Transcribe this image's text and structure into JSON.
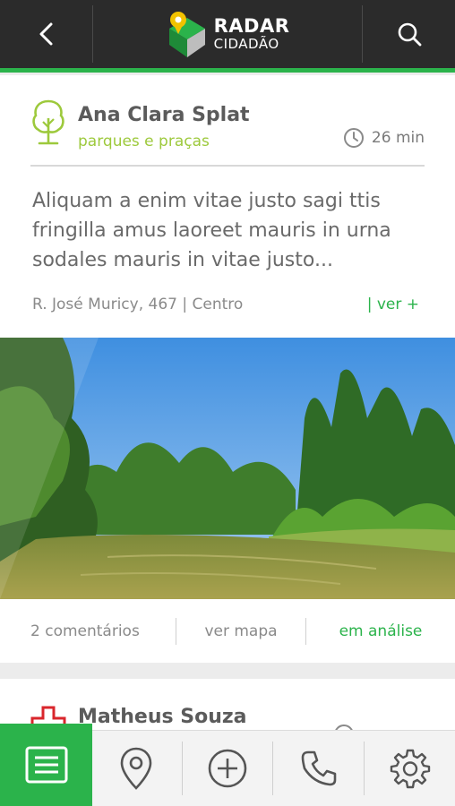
{
  "header": {
    "logo_line1": "RADAR",
    "logo_line2": "CIDADÃO",
    "back_icon": "chevron-left-icon",
    "search_icon": "search-icon",
    "accent": "#2bb34b"
  },
  "post": {
    "author": "Ana Clara Splat",
    "category": "parques e praças",
    "category_icon": "tree-icon",
    "category_color": "#9dc93c",
    "time": "26 min",
    "description": "Aliquam a enim vitae justo sagi ttis fringilla amus laoreet mauris in urna sodales mauris in vitae justo...",
    "address": "R. José Muricy, 467 | Centro",
    "more_link": "| ver +",
    "comments": "2 comentários",
    "map_link": "ver mapa",
    "status": "em análise"
  },
  "post2": {
    "author": "Matheus Souza",
    "category_icon": "health-cross-icon"
  },
  "nav": {
    "items": [
      {
        "icon": "list-icon",
        "active": true
      },
      {
        "icon": "map-pin-icon",
        "active": false
      },
      {
        "icon": "add-icon",
        "active": false
      },
      {
        "icon": "phone-icon",
        "active": false
      },
      {
        "icon": "gear-icon",
        "active": false
      }
    ]
  }
}
